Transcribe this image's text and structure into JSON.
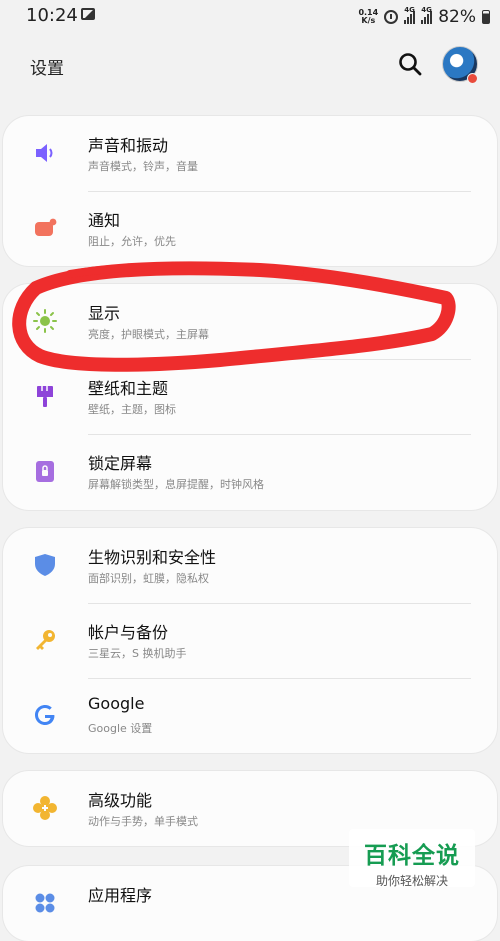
{
  "status_bar": {
    "time": "10:24",
    "net_speed_value": "0.14",
    "net_speed_unit": "K/s",
    "network_type_1": "4G",
    "network_type_2": "4G",
    "battery_percent": "82%"
  },
  "header": {
    "title": "设置",
    "search_icon": "search-icon",
    "avatar_badge_color": "#e94b3c"
  },
  "groups": [
    {
      "items": [
        {
          "title": "声音和振动",
          "subtitle": "声音模式，铃声，音量",
          "icon": "volume-icon",
          "color": "#7b61ff"
        },
        {
          "title": "通知",
          "subtitle": "阻止，允许，优先",
          "icon": "notification-icon",
          "color": "#f2735e"
        }
      ]
    },
    {
      "items": [
        {
          "title": "显示",
          "subtitle": "亮度，护眼模式，主屏幕",
          "icon": "brightness-icon",
          "color": "#8bc34a"
        },
        {
          "title": "壁纸和主题",
          "subtitle": "壁纸，主题，图标",
          "icon": "paintbrush-icon",
          "color": "#8e44d9"
        },
        {
          "title": "锁定屏幕",
          "subtitle": "屏幕解锁类型，息屏提醒，时钟风格",
          "icon": "lock-icon",
          "color": "#a66ee0"
        }
      ]
    },
    {
      "items": [
        {
          "title": "生物识别和安全性",
          "subtitle": "面部识别，虹膜，隐私权",
          "icon": "shield-icon",
          "color": "#5b8de6"
        },
        {
          "title": "帐户与备份",
          "subtitle": "三星云，S 换机助手",
          "icon": "key-icon",
          "color": "#f2b531"
        },
        {
          "title": "Google",
          "subtitle": "Google 设置",
          "icon": "google-icon",
          "color": "#4285f4"
        }
      ]
    },
    {
      "items": [
        {
          "title": "高级功能",
          "subtitle": "动作与手势，单手模式",
          "icon": "advanced-features-icon",
          "color": "#f2b531"
        }
      ]
    },
    {
      "items": [
        {
          "title": "应用程序",
          "subtitle": "",
          "icon": "apps-icon",
          "color": "#5b8de6"
        }
      ]
    }
  ],
  "annotation": {
    "color": "#ee2d2d",
    "target": "显示"
  },
  "watermark": {
    "title": "百科全说",
    "subtitle": "助你轻松解决"
  }
}
